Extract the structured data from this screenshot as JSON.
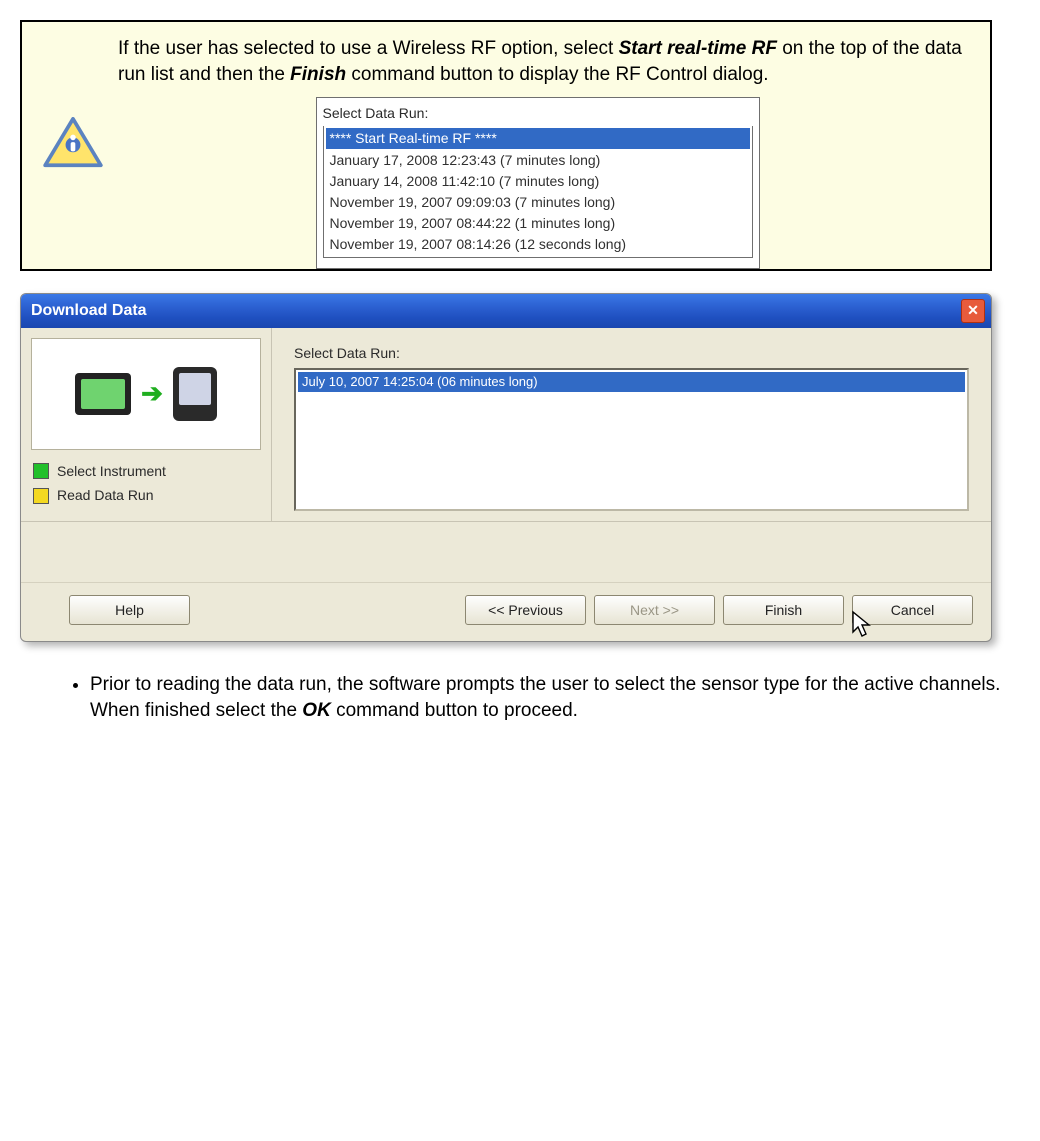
{
  "tip": {
    "text_parts": {
      "p1": "If the user has selected to use a Wireless RF option, select ",
      "b1": "Start real-time RF",
      "p2": " on the top of the data run list and then the ",
      "b2": "Finish",
      "p3": " command button to display the RF Control dialog."
    },
    "mini_list": {
      "label": "Select Data Run:",
      "selected": "**** Start Real-time RF ****",
      "rows": [
        "January 17, 2008   12:23:43 (7 minutes long)",
        "January 14, 2008   11:42:10 (7 minutes long)",
        "November 19, 2007   09:09:03 (7 minutes long)",
        "November 19, 2007   08:44:22 (1 minutes long)",
        "November 19, 2007   08:14:26 (12 seconds long)"
      ]
    }
  },
  "dialog": {
    "title": "Download Data",
    "steps": [
      {
        "label": "Select Instrument",
        "color": "green"
      },
      {
        "label": "Read Data Run",
        "color": "yellow"
      }
    ],
    "list_label": "Select Data Run:",
    "list_items": [
      "July 10, 2007   14:25:04   (06 minutes long)"
    ],
    "buttons": {
      "help": "Help",
      "previous": "<< Previous",
      "next": "Next >>",
      "finish": "Finish",
      "cancel": "Cancel"
    }
  },
  "bullet": {
    "p1": "Prior to reading the data run, the software prompts the user to select the sensor type for the active channels. When finished select the ",
    "b1": "OK",
    "p2": " command button to proceed."
  }
}
